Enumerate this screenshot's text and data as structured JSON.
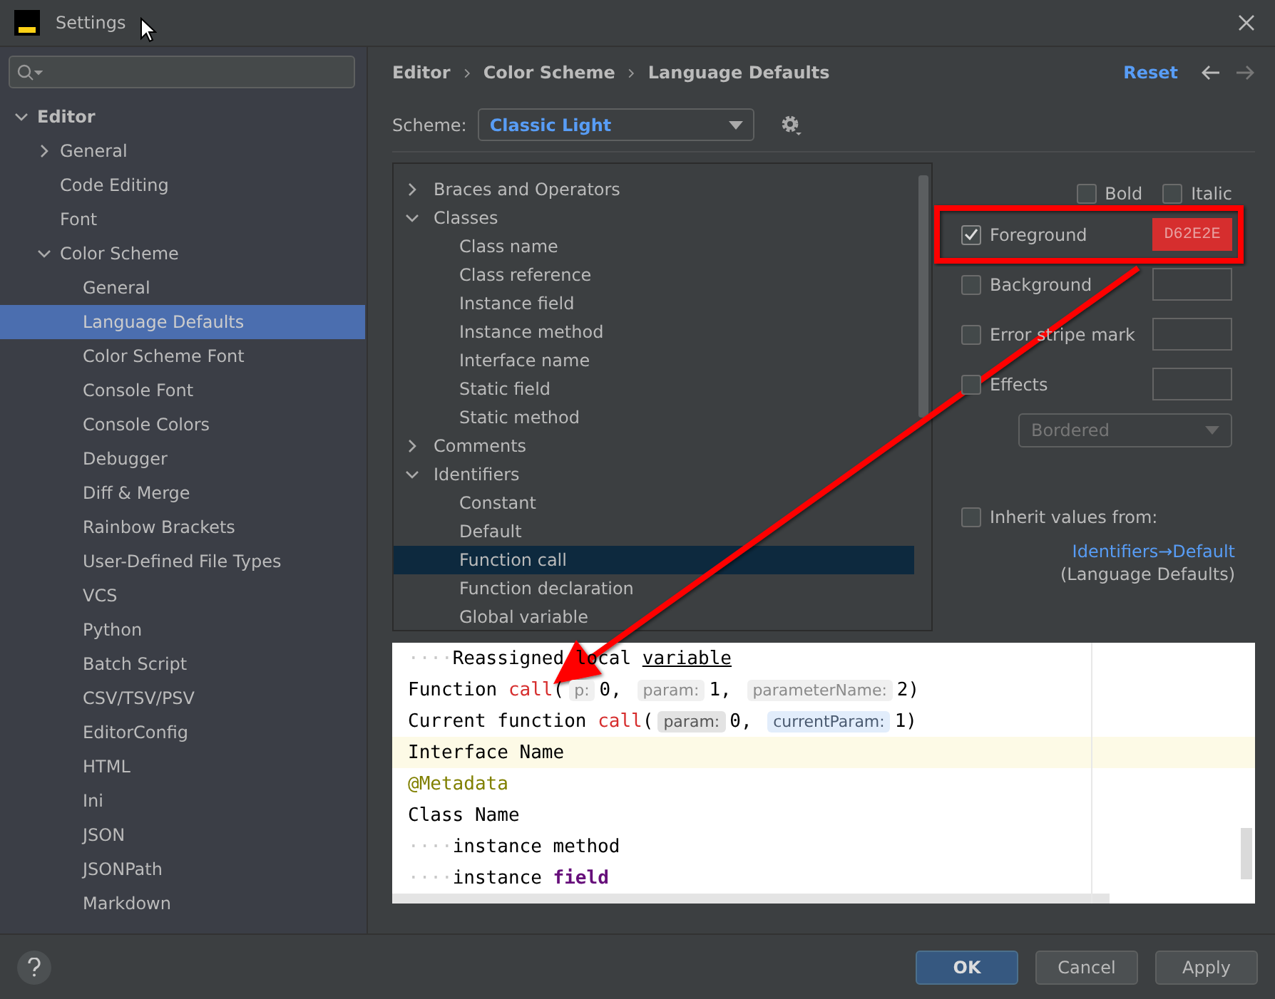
{
  "window": {
    "title": "Settings"
  },
  "sidebar": {
    "items": [
      {
        "label": "Editor",
        "expanded": true,
        "selected": false,
        "children": [
          {
            "label": "General",
            "expanded": false,
            "selected": false
          },
          {
            "label": "Code Editing",
            "selected": false
          },
          {
            "label": "Font",
            "selected": false
          },
          {
            "label": "Color Scheme",
            "expanded": true,
            "selected": false,
            "children": [
              {
                "label": "General",
                "selected": false
              },
              {
                "label": "Language Defaults",
                "selected": true
              },
              {
                "label": "Color Scheme Font",
                "selected": false
              },
              {
                "label": "Console Font",
                "selected": false
              },
              {
                "label": "Console Colors",
                "selected": false
              },
              {
                "label": "Debugger",
                "selected": false
              },
              {
                "label": "Diff & Merge",
                "selected": false
              },
              {
                "label": "Rainbow Brackets",
                "selected": false
              },
              {
                "label": "User-Defined File Types",
                "selected": false
              },
              {
                "label": "VCS",
                "selected": false
              },
              {
                "label": "Python",
                "selected": false
              },
              {
                "label": "Batch Script",
                "selected": false
              },
              {
                "label": "CSV/TSV/PSV",
                "selected": false
              },
              {
                "label": "EditorConfig",
                "selected": false
              },
              {
                "label": "HTML",
                "selected": false
              },
              {
                "label": "Ini",
                "selected": false
              },
              {
                "label": "JSON",
                "selected": false
              },
              {
                "label": "JSONPath",
                "selected": false
              },
              {
                "label": "Markdown",
                "selected": false
              }
            ]
          }
        ]
      }
    ]
  },
  "breadcrumb": [
    "Editor",
    "Color Scheme",
    "Language Defaults"
  ],
  "reset": "Reset",
  "scheme": {
    "label": "Scheme:",
    "value": "Classic Light"
  },
  "elements": [
    {
      "label": "Braces and Operators",
      "expanded": false,
      "selected": false
    },
    {
      "label": "Classes",
      "expanded": true,
      "selected": false,
      "children": [
        {
          "label": "Class name",
          "selected": false
        },
        {
          "label": "Class reference",
          "selected": false
        },
        {
          "label": "Instance field",
          "selected": false
        },
        {
          "label": "Instance method",
          "selected": false
        },
        {
          "label": "Interface name",
          "selected": false
        },
        {
          "label": "Static field",
          "selected": false
        },
        {
          "label": "Static method",
          "selected": false
        }
      ]
    },
    {
      "label": "Comments",
      "expanded": false,
      "selected": false
    },
    {
      "label": "Identifiers",
      "expanded": true,
      "selected": false,
      "children": [
        {
          "label": "Constant",
          "selected": false
        },
        {
          "label": "Default",
          "selected": false
        },
        {
          "label": "Function call",
          "selected": true
        },
        {
          "label": "Function declaration",
          "selected": false
        },
        {
          "label": "Global variable",
          "selected": false
        }
      ]
    }
  ],
  "style": [
    {
      "label": "Bold",
      "checked": false
    },
    {
      "label": "Italic",
      "checked": false
    }
  ],
  "attributes": [
    {
      "label": "Foreground",
      "checked": true,
      "value": "D62E2E",
      "color": "#d62e2e"
    },
    {
      "label": "Background",
      "checked": false
    },
    {
      "label": "Error stripe mark",
      "checked": false
    },
    {
      "label": "Effects",
      "checked": false
    }
  ],
  "effect_type": {
    "value": "Bordered",
    "disabled": true
  },
  "inherit": {
    "label": "Inherit values from:",
    "checked": false,
    "link": "Identifiers→Default",
    "note": "(Language Defaults)"
  },
  "preview": {
    "lines": [
      {
        "highlighted": false,
        "tokens": [
          {
            "kind": "ws",
            "text": "····"
          },
          {
            "kind": "plain",
            "text": "Reassigned local "
          },
          {
            "kind": "underline",
            "text": "variable"
          }
        ]
      },
      {
        "highlighted": false,
        "tokens": [
          {
            "kind": "plain",
            "text": "Function "
          },
          {
            "kind": "call",
            "text": "call"
          },
          {
            "kind": "plain",
            "text": "("
          },
          {
            "kind": "hint",
            "text": "p:"
          },
          {
            "kind": "plain",
            "text": "0, "
          },
          {
            "kind": "hint",
            "text": "param:"
          },
          {
            "kind": "plain",
            "text": "1, "
          },
          {
            "kind": "hint",
            "text": "parameterName:"
          },
          {
            "kind": "plain",
            "text": "2)"
          }
        ]
      },
      {
        "highlighted": false,
        "tokens": [
          {
            "kind": "plain",
            "text": "Current function "
          },
          {
            "kind": "call",
            "text": "call"
          },
          {
            "kind": "plain",
            "text": "("
          },
          {
            "kind": "hint_strong",
            "text": "param:"
          },
          {
            "kind": "plain",
            "text": "0, "
          },
          {
            "kind": "hint_current",
            "text": "currentParam:"
          },
          {
            "kind": "plain",
            "text": "1)"
          }
        ]
      },
      {
        "highlighted": true,
        "tokens": [
          {
            "kind": "plain",
            "text": "Interface Name"
          }
        ]
      },
      {
        "highlighted": false,
        "tokens": [
          {
            "kind": "annotation",
            "text": "@Metadata"
          }
        ]
      },
      {
        "highlighted": false,
        "tokens": [
          {
            "kind": "plain",
            "text": "Class Name"
          }
        ]
      },
      {
        "highlighted": false,
        "tokens": [
          {
            "kind": "ws",
            "text": "····"
          },
          {
            "kind": "plain",
            "text": "instance method"
          }
        ]
      },
      {
        "highlighted": false,
        "tokens": [
          {
            "kind": "ws",
            "text": "····"
          },
          {
            "kind": "plain",
            "text": "instance "
          },
          {
            "kind": "field",
            "text": "field"
          }
        ]
      }
    ]
  },
  "buttons": [
    {
      "label": "OK",
      "kind": "primary"
    },
    {
      "label": "Cancel",
      "kind": "normal"
    },
    {
      "label": "Apply",
      "kind": "normal"
    }
  ]
}
